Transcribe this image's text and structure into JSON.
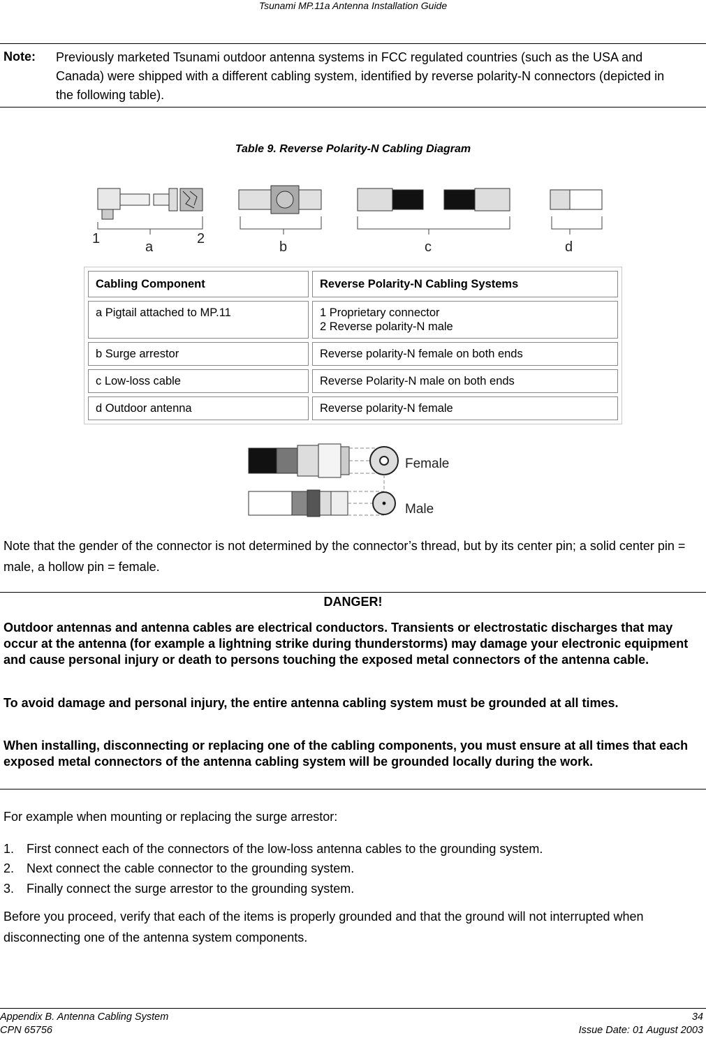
{
  "header": {
    "title": "Tsunami MP.11a Antenna Installation Guide"
  },
  "note": {
    "label": "Note:",
    "text": "Previously marketed Tsunami outdoor antenna systems in FCC regulated countries (such as the USA and Canada) were shipped with a different cabling system, identified by reverse polarity-N connectors (depicted in the following table)."
  },
  "table_caption": "Table 9.  Reverse Polarity-N Cabling Diagram",
  "diagram_labels": {
    "one": "1",
    "a": "a",
    "two": "2",
    "b": "b",
    "c": "c",
    "d": "d"
  },
  "table": {
    "headers": [
      "Cabling Component",
      "Reverse Polarity-N Cabling Systems"
    ],
    "rows": [
      {
        "component": "a  Pigtail attached to MP.11",
        "system_line1": "1  Proprietary connector",
        "system_line2": "2  Reverse polarity-N male"
      },
      {
        "component": "b  Surge arrestor",
        "system_line1": "Reverse polarity-N female on both ends"
      },
      {
        "component": "c  Low-loss cable",
        "system_line1": "Reverse Polarity-N male on both ends"
      },
      {
        "component": "d  Outdoor antenna",
        "system_line1": "Reverse polarity-N female"
      }
    ]
  },
  "gender_diagram": {
    "female_label": "Female",
    "male_label": "Male"
  },
  "gender_note": "Note that the gender of the connector is not determined by the connector’s thread, but by its center pin; a solid center pin = male, a hollow pin = female.",
  "danger": {
    "title": "DANGER!",
    "paragraphs": [
      "Outdoor antennas and antenna cables are electrical conductors. Transients or electrostatic discharges that may occur at the antenna (for example a lightning strike during thunderstorms) may damage your electronic equipment and cause personal injury or death to persons touching the exposed metal connectors of the antenna cable.",
      "To avoid damage and personal injury, the entire antenna cabling system must be grounded at all times.",
      "When installing, disconnecting or replacing one of the cabling components, you must ensure at all times that each exposed metal connectors of the antenna cabling system will be grounded locally during the work."
    ]
  },
  "example_intro": "For example when mounting or replacing the surge arrestor:",
  "steps": [
    {
      "num": "1.",
      "text": "First connect each of the connectors of the low-loss antenna cables to the grounding system."
    },
    {
      "num": "2.",
      "text": "Next connect the cable connector to the grounding system."
    },
    {
      "num": "3.",
      "text": "Finally connect the surge arrestor to the grounding system."
    }
  ],
  "closing": "Before you proceed, verify that each of the items is properly grounded and that the ground will not interrupted when disconnecting one of the antenna system components.",
  "footer": {
    "section": "Appendix B.  Antenna Cabling System",
    "page": "34",
    "cpn": "CPN 65756",
    "issue_date": "Issue Date:  01 August 2003"
  }
}
